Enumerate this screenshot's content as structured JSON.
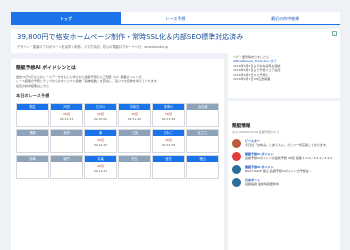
{
  "nav": {
    "tabs": [
      "トップ",
      "レース予想",
      "最近の的中結果"
    ]
  },
  "ad": {
    "headline": "39,800円で格安ホームページ制作・常時SSL化＆内部SEO標準対応済み",
    "sub": "デザイン・集客のプロがページを素早く制作。スマホ対応。初心の電脳ログボードへ行、amaststudio.jp",
    "mark": "i"
  },
  "main": {
    "title": "競艇予想AI ボイドシンとは",
    "description": [
      "過去10万5万以上のレースデータをもとに作られた競艇予想の人工知能（AI）搭載ボイドンが、",
      "レース結果の予想とチップからのオリジナル指数『指神指数』を算出し、買いつき自体を考えてくれます。",
      "最近の的中結果はこちら"
    ],
    "section_title": "本日のレース予想",
    "races": [
      {
        "venue": "桐生",
        "state": "open",
        "num": "",
        "time": ""
      },
      {
        "venue": "戸田",
        "state": "open",
        "num": "9R目",
        "time": "09:11:33"
      },
      {
        "venue": "江戸川",
        "state": "open",
        "num": "3R目",
        "time": "09:10:00"
      },
      {
        "venue": "平和島",
        "state": "open",
        "num": "4R目",
        "time": "09:11:40"
      },
      {
        "venue": "多摩川",
        "state": "open",
        "num": "5R目",
        "time": "09:11:48"
      },
      {
        "venue": "浜名湖",
        "state": "closed",
        "num": "",
        "time": ""
      },
      {
        "venue": "蒲郡",
        "state": "closed",
        "num": "",
        "time": ""
      },
      {
        "venue": "常滑",
        "state": "closed",
        "num": "",
        "time": ""
      },
      {
        "venue": "津",
        "state": "open",
        "num": "5R目",
        "time": "09:12:25"
      },
      {
        "venue": "三国",
        "state": "closed",
        "num": "",
        "time": ""
      },
      {
        "venue": "びわこ",
        "state": "open",
        "num": "4R目",
        "time": "09:12:35"
      },
      {
        "venue": "住之江",
        "state": "closed",
        "num": "",
        "time": ""
      },
      {
        "venue": "尼崎",
        "state": "closed",
        "num": "",
        "time": ""
      },
      {
        "venue": "鳴門",
        "state": "closed",
        "num": "",
        "time": ""
      },
      {
        "venue": "丸亀",
        "state": "open",
        "num": "4R目",
        "time": "09:11:47"
      },
      {
        "venue": "児島",
        "state": "closed",
        "num": "",
        "time": ""
      },
      {
        "venue": "宮島",
        "state": "open",
        "num": "",
        "time": ""
      },
      {
        "venue": "徳山",
        "state": "open",
        "num": "",
        "time": ""
      }
    ]
  },
  "sidebar": {
    "box1_lines": [
      "バグ・要望等ありましたら",
      "@BoatRaceAI_Prediction まで",
      "2018年6月6日より中央競馬も開始",
      "2018年6月5日より予想スコア追加",
      "2018年6月5日から予想に...",
      "2018年6月1日 PR広告掲載"
    ],
    "box1_link_index": 1,
    "title": "競艇情報",
    "subtitle": "@AI_PREDICTION 競艇予想AIにて",
    "feed": [
      {
        "name": "ビースター",
        "text": "今日は「お休み」と言う人に。ガッツ一杯応援しております。",
        "avatar": "img"
      },
      {
        "name": "競艇予想AI ボイドン",
        "text": "競艇予想AIボイドンの最新予想 3R目 投票 1-3-4 / 3-4-2 / 3-4-5",
        "avatar": "red"
      },
      {
        "name": "競艇予想AI ボイドン",
        "text": "BOAT RACE 徳山 競艇予想AIボイドンの予想は...",
        "avatar": "dark"
      },
      {
        "name": "日本ボート",
        "text": "競艇速報 最新情報更新中",
        "avatar": "dark"
      }
    ]
  }
}
